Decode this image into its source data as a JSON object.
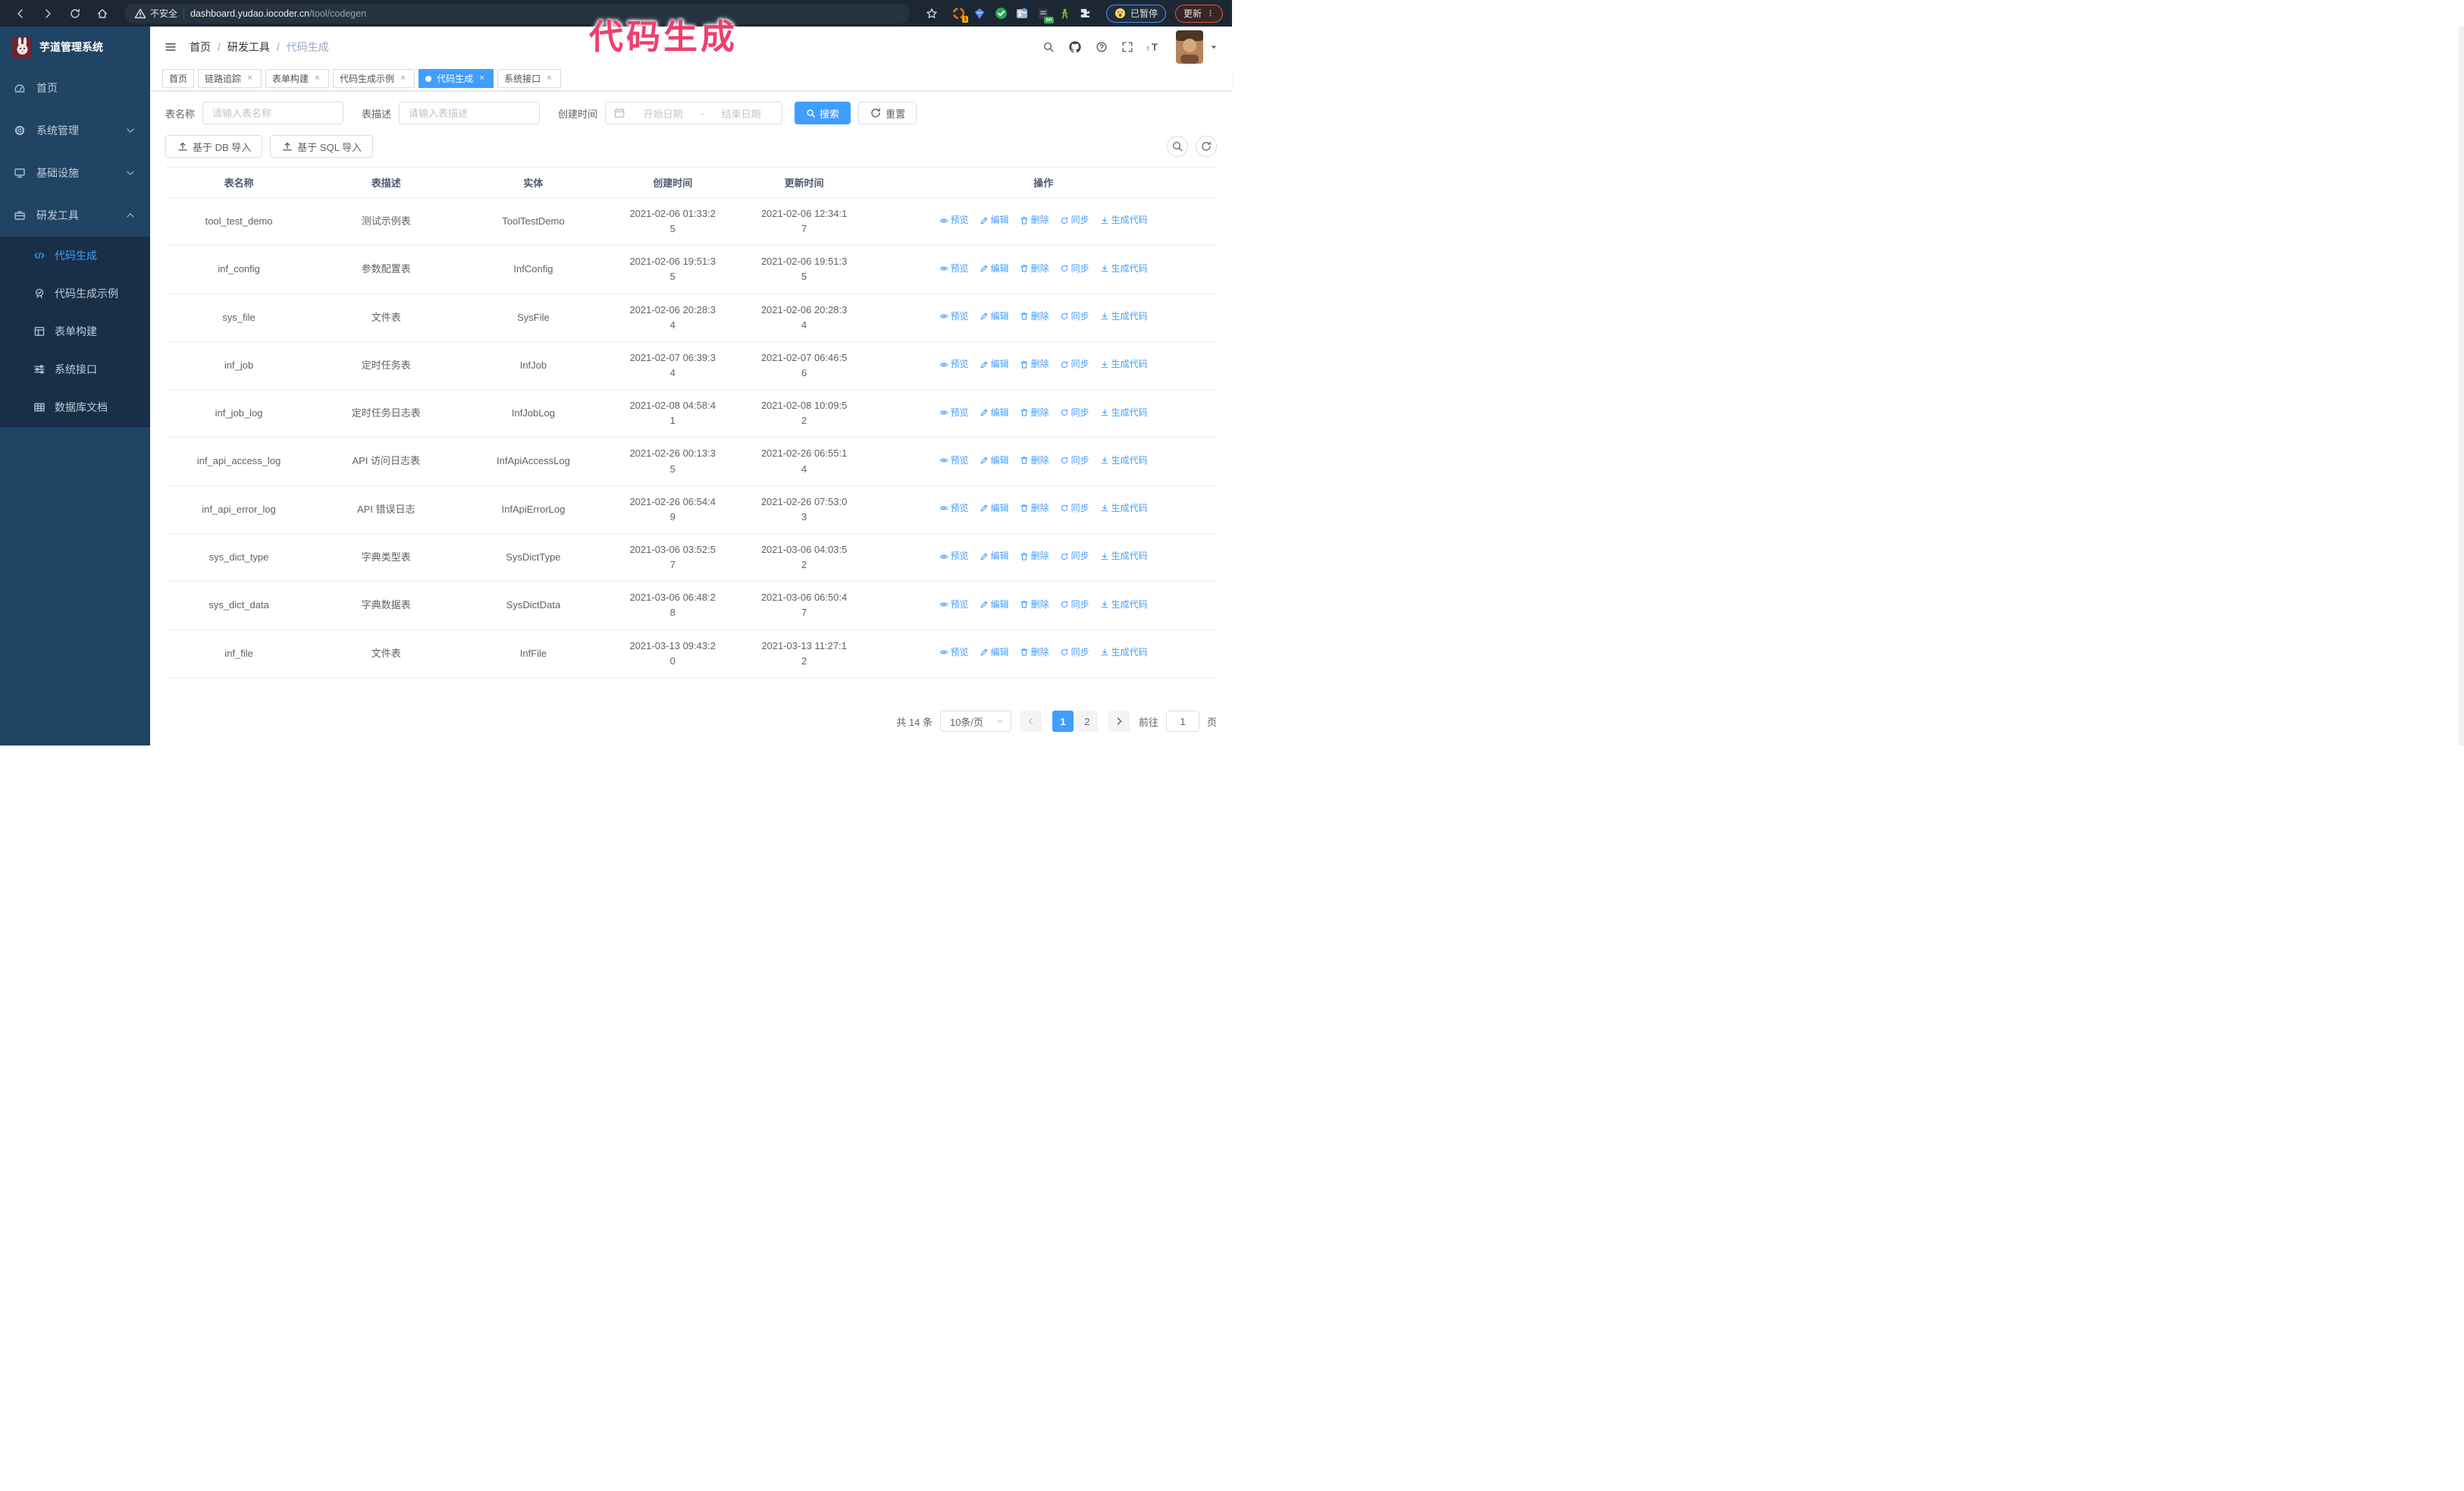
{
  "annotation": {
    "text": "代码生成"
  },
  "browser": {
    "security_label": "不安全",
    "url_host": "dashboard.yudao.iocoder.cn",
    "url_path": "/tool/codegen",
    "paused_badge": "已暂停",
    "update_button": "更新",
    "update_menu_dots": "⋮",
    "extensions": [
      {
        "id": "orange-extension",
        "icon": "ext-orange-icon",
        "badge": "1"
      },
      {
        "id": "diamond-extension",
        "icon": "ext-diamond-icon",
        "badge": ""
      },
      {
        "id": "green-check-extension",
        "icon": "ext-check-icon",
        "badge": ""
      },
      {
        "id": "grid-extension",
        "icon": "ext-grid-icon",
        "badge": ""
      },
      {
        "id": "switch-extension",
        "icon": "ext-dark-icon",
        "badge": "on"
      },
      {
        "id": "green-person-extension",
        "icon": "ext-person-icon",
        "badge": ""
      },
      {
        "id": "puzzle-extension",
        "icon": "ext-puzzle-icon",
        "badge": ""
      }
    ]
  },
  "sidebar": {
    "logo_title": "芋道管理系统",
    "items": [
      {
        "id": "home",
        "label": "首页",
        "icon": "dashboard-icon"
      },
      {
        "id": "system",
        "label": "系统管理",
        "icon": "gear-icon",
        "chevron": "down"
      },
      {
        "id": "infra",
        "label": "基础设施",
        "icon": "monitor-icon",
        "chevron": "down"
      },
      {
        "id": "devtools",
        "label": "研发工具",
        "icon": "toolbox-icon",
        "chevron": "up",
        "expanded": true
      }
    ],
    "submenu": [
      {
        "id": "codegen",
        "label": "代码生成",
        "icon": "code-icon",
        "active": true
      },
      {
        "id": "codegen-example",
        "label": "代码生成示例",
        "icon": "badge-check-icon"
      },
      {
        "id": "form-build",
        "label": "表单构建",
        "icon": "form-icon"
      },
      {
        "id": "system-api",
        "label": "系统接口",
        "icon": "sliders-icon"
      },
      {
        "id": "db-doc",
        "label": "数据库文档",
        "icon": "table-grid-icon"
      }
    ]
  },
  "header": {
    "breadcrumb": [
      "首页",
      "研发工具",
      "代码生成"
    ]
  },
  "tags": [
    {
      "label": "首页",
      "closable": false,
      "active": false
    },
    {
      "label": "链路追踪",
      "closable": true,
      "active": false
    },
    {
      "label": "表单构建",
      "closable": true,
      "active": false
    },
    {
      "label": "代码生成示例",
      "closable": true,
      "active": false
    },
    {
      "label": "代码生成",
      "closable": true,
      "active": true
    },
    {
      "label": "系统接口",
      "closable": true,
      "active": false
    }
  ],
  "search": {
    "name_label": "表名称",
    "name_placeholder": "请输入表名称",
    "desc_label": "表描述",
    "desc_placeholder": "请输入表描述",
    "time_label": "创建时间",
    "start_placeholder": "开始日期",
    "range_separator": "-",
    "end_placeholder": "结束日期",
    "search_button": "搜索",
    "reset_button": "重置"
  },
  "toolbar": {
    "import_db": "基于 DB 导入",
    "import_sql": "基于 SQL 导入"
  },
  "table": {
    "columns": [
      "表名称",
      "表描述",
      "实体",
      "创建时间",
      "更新时间",
      "操作"
    ],
    "row_actions": [
      {
        "name": "preview-link",
        "label": "预览",
        "icon": "eye-icon"
      },
      {
        "name": "edit-link",
        "label": "编辑",
        "icon": "edit-icon"
      },
      {
        "name": "delete-link",
        "label": "删除",
        "icon": "delete-icon"
      },
      {
        "name": "sync-link",
        "label": "同步",
        "icon": "sync-icon"
      },
      {
        "name": "generate-code-link",
        "label": "生成代码",
        "icon": "download-icon"
      }
    ],
    "rows": [
      {
        "name": "tool_test_demo",
        "desc": "测试示例表",
        "entity": "ToolTestDemo",
        "created": "2021-02-06 01:33:25",
        "updated": "2021-02-06 12:34:17"
      },
      {
        "name": "inf_config",
        "desc": "参数配置表",
        "entity": "InfConfig",
        "created": "2021-02-06 19:51:35",
        "updated": "2021-02-06 19:51:35"
      },
      {
        "name": "sys_file",
        "desc": "文件表",
        "entity": "SysFile",
        "created": "2021-02-06 20:28:34",
        "updated": "2021-02-06 20:28:34"
      },
      {
        "name": "inf_job",
        "desc": "定时任务表",
        "entity": "InfJob",
        "created": "2021-02-07 06:39:34",
        "updated": "2021-02-07 06:46:56"
      },
      {
        "name": "inf_job_log",
        "desc": "定时任务日志表",
        "entity": "InfJobLog",
        "created": "2021-02-08 04:58:41",
        "updated": "2021-02-08 10:09:52"
      },
      {
        "name": "inf_api_access_log",
        "desc": "API 访问日志表",
        "entity": "InfApiAccessLog",
        "created": "2021-02-26 00:13:35",
        "updated": "2021-02-26 06:55:14"
      },
      {
        "name": "inf_api_error_log",
        "desc": "API 错误日志",
        "entity": "InfApiErrorLog",
        "created": "2021-02-26 06:54:49",
        "updated": "2021-02-26 07:53:03"
      },
      {
        "name": "sys_dict_type",
        "desc": "字典类型表",
        "entity": "SysDictType",
        "created": "2021-03-06 03:52:57",
        "updated": "2021-03-06 04:03:52"
      },
      {
        "name": "sys_dict_data",
        "desc": "字典数据表",
        "entity": "SysDictData",
        "created": "2021-03-06 06:48:28",
        "updated": "2021-03-06 06:50:47"
      },
      {
        "name": "inf_file",
        "desc": "文件表",
        "entity": "InfFile",
        "created": "2021-03-13 09:43:20",
        "updated": "2021-03-13 11:27:12"
      }
    ]
  },
  "pagination": {
    "total_text": "共 14 条",
    "page_size": "10条/页",
    "pages": [
      "1",
      "2"
    ],
    "active_page": "1",
    "goto_label": "前往",
    "goto_value": "1",
    "goto_suffix": "页"
  },
  "colors": {
    "accent": "#409eff",
    "annotation_pink": "#ee3f6e",
    "sidebar_bg": "#204463",
    "submenu_bg": "#182f47"
  }
}
